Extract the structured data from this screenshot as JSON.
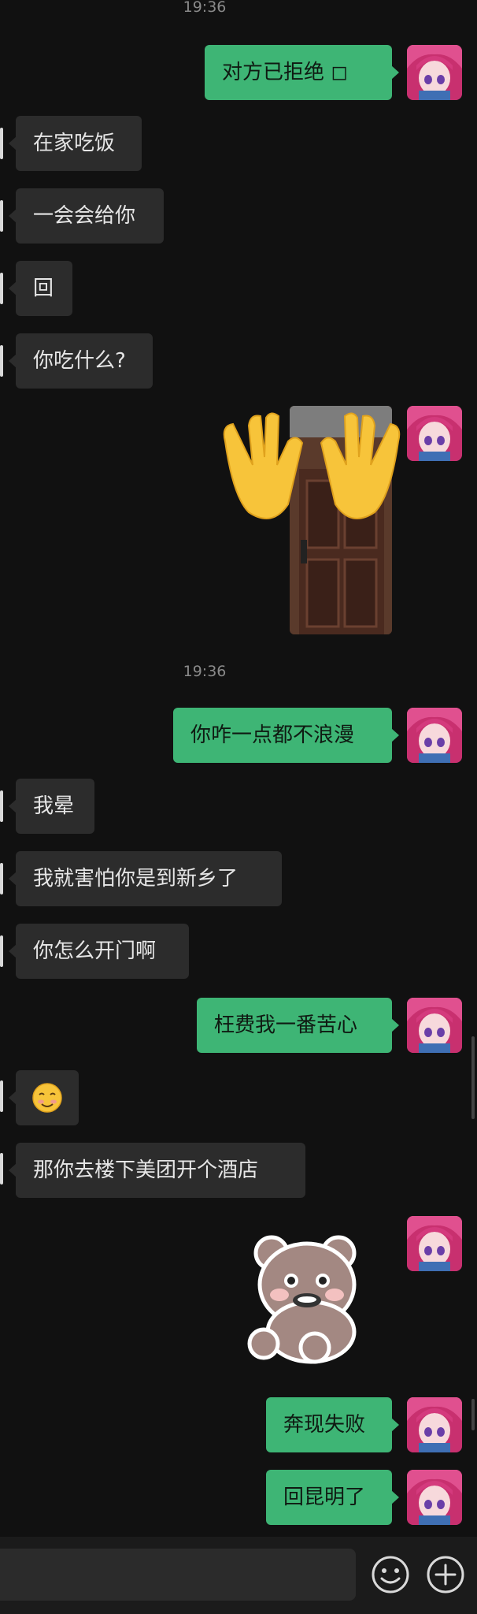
{
  "timestamps": [
    "19:36",
    "19:36"
  ],
  "messages": [
    {
      "side": "out",
      "text": "对方已拒绝 ◻"
    },
    {
      "side": "in",
      "text": "在家吃饭"
    },
    {
      "side": "in",
      "text": "一会会给你"
    },
    {
      "side": "in",
      "text": "回"
    },
    {
      "side": "in",
      "text": "你吃什么?"
    },
    {
      "side": "out",
      "text": "你咋一点都不浪漫"
    },
    {
      "side": "in",
      "text": "我晕"
    },
    {
      "side": "in",
      "text": "我就害怕你是到新乡了"
    },
    {
      "side": "in",
      "text": "你怎么开门啊"
    },
    {
      "side": "out",
      "text": "枉费我一番苦心"
    },
    {
      "side": "in",
      "text": "🙂"
    },
    {
      "side": "in",
      "text": "那你去楼下美团开个酒店"
    },
    {
      "side": "out",
      "text": "奔现失败"
    },
    {
      "side": "out",
      "text": "回昆明了"
    }
  ],
  "icons": {
    "wave": "raising-hands-emoji",
    "sticker": "crying-bear-sticker",
    "emoji_button": "smile-icon",
    "more_button": "plus-icon"
  },
  "colors": {
    "background": "#111111",
    "outgoing_bubble": "#3eb575",
    "incoming_bubble": "#2c2c2c"
  }
}
